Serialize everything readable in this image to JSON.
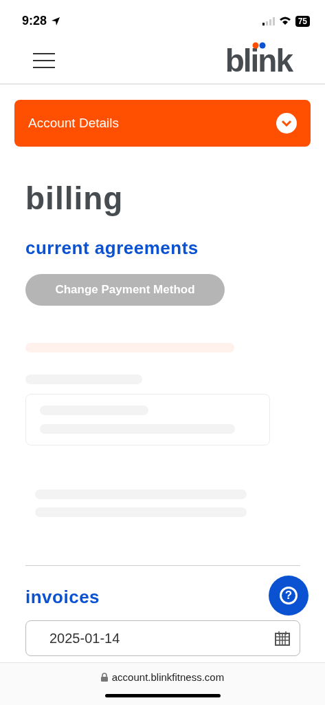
{
  "status_bar": {
    "time": "9:28",
    "battery": "75"
  },
  "header": {
    "logo": "blink"
  },
  "account_bar": {
    "label": "Account Details",
    "expanded": false
  },
  "page_title": "billing",
  "agreements": {
    "heading": "current agreements",
    "button": {
      "label": "Change Payment Method",
      "disabled": true
    }
  },
  "invoices": {
    "heading": "invoices",
    "date_field": {
      "value": "2025-01-14"
    }
  },
  "help_button": {
    "label": "?"
  },
  "browser_bar": {
    "url": "account.blinkfitness.com"
  }
}
